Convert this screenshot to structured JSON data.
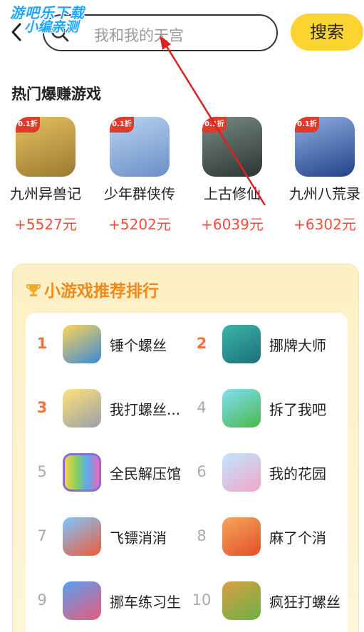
{
  "watermark": {
    "line1": "游吧乐下载",
    "line2": "小编亲测"
  },
  "search": {
    "placeholder": "我和我的天宫",
    "button": "搜索"
  },
  "hot": {
    "title": "热门爆赚游戏",
    "discount_tag": "0.1折",
    "items": [
      {
        "name": "九州异兽记",
        "reward": "+5527元",
        "color": "#c8a24a"
      },
      {
        "name": "少年群侠传",
        "reward": "+5202元",
        "color": "#7fa7d8"
      },
      {
        "name": "上古修仙",
        "reward": "+6039元",
        "color": "#4a5a55"
      },
      {
        "name": "九州八荒录",
        "reward": "+6302元",
        "color": "#3b5da8"
      }
    ]
  },
  "mini": {
    "title": "小游戏推荐排行",
    "items": [
      {
        "rank": "1",
        "name": "锤个螺丝",
        "color": "#f0b429"
      },
      {
        "rank": "2",
        "name": "挪牌大师",
        "color": "#2aa198"
      },
      {
        "rank": "3",
        "name": "我打螺丝...",
        "color": "#f5c842"
      },
      {
        "rank": "4",
        "name": "拆了我吧",
        "color": "#58c4e8"
      },
      {
        "rank": "5",
        "name": "全民解压馆",
        "color": "#a07bd8"
      },
      {
        "rank": "6",
        "name": "我的花园",
        "color": "#7ec8f0"
      },
      {
        "rank": "7",
        "name": "飞镖消消",
        "color": "#ef5a48"
      },
      {
        "rank": "8",
        "name": "麻了个消",
        "color": "#f07a3a"
      },
      {
        "rank": "9",
        "name": "挪车练习生",
        "color": "#3d7fd8"
      },
      {
        "rank": "10",
        "name": "疯狂打螺丝",
        "color": "#d79a3a"
      }
    ]
  }
}
